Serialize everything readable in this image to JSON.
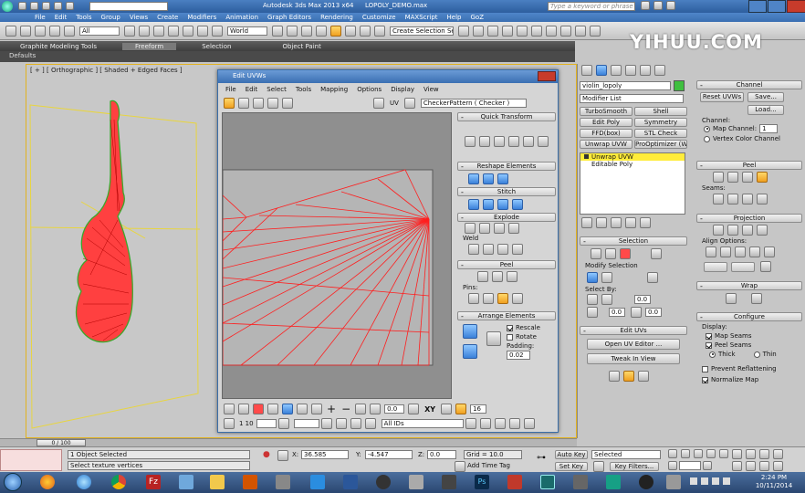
{
  "titlebar": {
    "workspace": "Workspace: Default",
    "app_title": "Autodesk 3ds Max  2013 x64",
    "file_name": "LOPOLY_DEMO.max",
    "search_placeholder": "Type a keyword or phrase"
  },
  "menubar": [
    "File",
    "Edit",
    "Tools",
    "Group",
    "Views",
    "Create",
    "Modifiers",
    "Animation",
    "Graph Editors",
    "Rendering",
    "Customize",
    "MAXScript",
    "Help",
    "GoZ"
  ],
  "main_toolbar": {
    "selection_filter": "All",
    "ref_coord": "World",
    "named_selection": "Create Selection Se"
  },
  "ribbon_tabs": [
    "Graphite Modeling Tools",
    "Freeform",
    "Selection",
    "Object Paint"
  ],
  "ribbon_label": "Defaults",
  "watermark": "YIHUU.COM",
  "viewport": {
    "label": "[ + ] [ Orthographic ] [ Shaded + Edged Faces ]"
  },
  "uvw_editor": {
    "title": "Edit UVWs",
    "menu": [
      "File",
      "Edit",
      "Select",
      "Tools",
      "Mapping",
      "Options",
      "Display",
      "View"
    ],
    "uv_label": "UV",
    "texture_dropdown": "CheckerPattern ( Checker )",
    "panels": {
      "quick_transform": "Quick Transform",
      "reshape": "Reshape Elements",
      "stitch": "Stitch",
      "explode": "Explode",
      "weld": "Weld",
      "peel": "Peel",
      "pins": "Pins:",
      "arrange": "Arrange Elements",
      "rescale": "Rescale",
      "rotate": "Rotate",
      "padding_label": "Padding:",
      "padding_value": "0.02"
    },
    "bottom": {
      "u_value": "0.0",
      "xy_label": "XY",
      "spin_val": "16",
      "page_label": "1 10",
      "all_ids": "All IDs"
    }
  },
  "cmd_panel": {
    "object_name": "violin_lopoly",
    "modifier_list": "Modifier List",
    "mod_buttons": [
      "TurboSmooth",
      "Shell",
      "Edit Poly",
      "Symmetry",
      "FFD(box)",
      "STL Check",
      "Unwrap UVW",
      "ProOptimizer (WS)"
    ],
    "stack": [
      "Unwrap UVW",
      "Editable Poly"
    ],
    "selection_hdr": "Selection",
    "modify_selection": "Modify Selection",
    "select_by": "Select By:",
    "sel_val1": "0.0",
    "sel_val2": "0.0",
    "sel_val3": "0",
    "sel_val4": "0.0",
    "edit_uvs": "Edit UVs",
    "open_uv_editor": "Open UV Editor ...",
    "tweak_in_view": "Tweak In View",
    "channel_hdr": "Channel",
    "reset_uvws": "Reset UVWs",
    "save": "Save...",
    "load": "Load...",
    "channel_label": "Channel:",
    "map_channel": "Map Channel:",
    "map_channel_val": "1",
    "vertex_color_channel": "Vertex Color Channel",
    "peel_hdr": "Peel",
    "seams_label": "Seams:",
    "projection_hdr": "Projection",
    "align_options": "Align Options:",
    "wrap_hdr": "Wrap",
    "configure_hdr": "Configure",
    "display_label": "Display:",
    "map_seams": "Map Seams",
    "peel_seams": "Peel Seams",
    "thick": "Thick",
    "thin": "Thin",
    "prevent_reflattening": "Prevent Reflattening",
    "normalize_map": "Normalize Map"
  },
  "status": {
    "timeline": "0 / 100",
    "objects_selected": "1 Object Selected",
    "prompt": "Select texture vertices",
    "x_val": "36.585",
    "y_val": "-4.547",
    "z_val": "0.0",
    "grid": "Grid = 10.0",
    "add_time_tag": "Add Time Tag",
    "auto_key": "Auto Key",
    "key_mode": "Selected",
    "set_key": "Set Key",
    "key_filters": "Key Filters..."
  },
  "taskbar": {
    "time": "2:24 PM",
    "date": "10/11/2014"
  },
  "colors": {
    "wire": "#ff1e1e",
    "viewport_bg": "#c8c8c8",
    "uv_bg": "#8f8f8f",
    "title_blue": "#2d6ab5",
    "selected_mod": "#ffec3a"
  }
}
